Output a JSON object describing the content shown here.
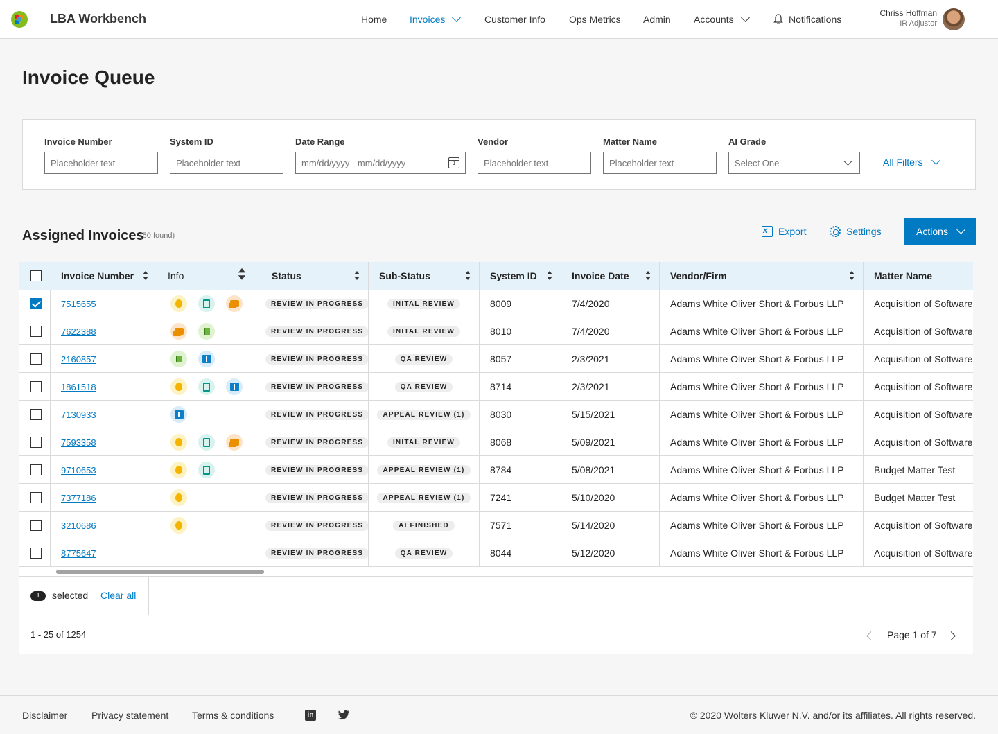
{
  "header": {
    "app_title": "LBA Workbench",
    "nav": [
      {
        "label": "Home",
        "left": 0
      },
      {
        "label": "Invoices"
      },
      {
        "label": "Customer Info"
      },
      {
        "label": "Ops Metrics"
      },
      {
        "label": "Admin"
      },
      {
        "label": "Accounts"
      },
      {
        "label": "Notifications"
      }
    ],
    "user_name": "Chriss Hoffman",
    "user_role": "IR Adjustor"
  },
  "page_title": "Invoice Queue",
  "filters": {
    "invoice_number_label": "Invoice Number",
    "invoice_number_placeholder": "Placeholder text",
    "system_id_label": "System ID",
    "system_id_placeholder": "Placeholder text",
    "date_range_label": "Date Range",
    "date_range_placeholder": "mm/dd/yyyy - mm/dd/yyyy",
    "vendor_label": "Vendor",
    "vendor_placeholder": "Placeholder text",
    "matter_name_label": "Matter Name",
    "matter_name_placeholder": "Placeholder text",
    "ai_grade_label": "AI Grade",
    "ai_grade_value": "Select One",
    "all_filters": "All Filters"
  },
  "section": {
    "title": "Assigned Invoices",
    "found": "(50 found)",
    "export": "Export",
    "settings": "Settings",
    "actions": "Actions"
  },
  "table": {
    "columns": [
      "Invoice Number",
      "Info",
      "Status",
      "Sub-Status",
      "System ID",
      "Invoice Date",
      "Vendor/Firm",
      "Matter Name"
    ],
    "rows": [
      {
        "checked": true,
        "invoice": "7515655",
        "icons": [
          "money-icon",
          "document-icon",
          "chat-icon"
        ],
        "status": "REVIEW IN PROGRESS",
        "substatus": "INITAL REVIEW",
        "system_id": "8009",
        "date": "7/4/2020",
        "vendor": "Adams White Oliver Short & Forbus LLP",
        "matter": "Acquisition of Software"
      },
      {
        "checked": false,
        "invoice": "7622388",
        "icons": [
          "chat-icon",
          "flag-icon"
        ],
        "status": "REVIEW IN PROGRESS",
        "substatus": "INITAL REVIEW",
        "system_id": "8010",
        "date": "7/4/2020",
        "vendor": "Adams White Oliver Short & Forbus LLP",
        "matter": "Acquisition of Software"
      },
      {
        "checked": false,
        "invoice": "2160857",
        "icons": [
          "flag-icon",
          "book-icon"
        ],
        "status": "REVIEW IN PROGRESS",
        "substatus": "QA REVIEW",
        "system_id": "8057",
        "date": "2/3/2021",
        "vendor": "Adams White Oliver Short & Forbus LLP",
        "matter": "Acquisition of Software"
      },
      {
        "checked": false,
        "invoice": "1861518",
        "icons": [
          "money-icon",
          "document-icon",
          "book-icon"
        ],
        "status": "REVIEW IN PROGRESS",
        "substatus": "QA REVIEW",
        "system_id": "8714",
        "date": "2/3/2021",
        "vendor": "Adams White Oliver Short & Forbus LLP",
        "matter": "Acquisition of Software"
      },
      {
        "checked": false,
        "invoice": "7130933",
        "icons": [
          "book-icon"
        ],
        "status": "REVIEW IN PROGRESS",
        "substatus": "APPEAL REVIEW (1)",
        "system_id": "8030",
        "date": "5/15/2021",
        "vendor": "Adams White Oliver Short & Forbus LLP",
        "matter": "Acquisition of Software"
      },
      {
        "checked": false,
        "invoice": "7593358",
        "icons": [
          "money-icon",
          "document-icon",
          "chat-icon"
        ],
        "status": "REVIEW IN PROGRESS",
        "substatus": "INITAL REVIEW",
        "system_id": "8068",
        "date": "5/09/2021",
        "vendor": "Adams White Oliver Short & Forbus LLP",
        "matter": "Acquisition of Software"
      },
      {
        "checked": false,
        "invoice": "9710653",
        "icons": [
          "money-icon",
          "document-icon"
        ],
        "status": "REVIEW IN PROGRESS",
        "substatus": "APPEAL REVIEW (1)",
        "system_id": "8784",
        "date": "5/08/2021",
        "vendor": "Adams White Oliver Short & Forbus LLP",
        "matter": "Budget Matter Test"
      },
      {
        "checked": false,
        "invoice": "7377186",
        "icons": [
          "money-icon"
        ],
        "status": "REVIEW IN PROGRESS",
        "substatus": "APPEAL REVIEW (1)",
        "system_id": "7241",
        "date": "5/10/2020",
        "vendor": "Adams White Oliver Short & Forbus LLP",
        "matter": "Budget Matter Test"
      },
      {
        "checked": false,
        "invoice": "3210686",
        "icons": [
          "money-icon"
        ],
        "status": "REVIEW IN PROGRESS",
        "substatus": "AI FINISHED",
        "system_id": "7571",
        "date": "5/14/2020",
        "vendor": "Adams White Oliver Short & Forbus LLP",
        "matter": "Acquisition of Software"
      },
      {
        "checked": false,
        "invoice": "8775647",
        "icons": [],
        "status": "REVIEW IN PROGRESS",
        "substatus": "QA REVIEW",
        "system_id": "8044",
        "date": "5/12/2020",
        "vendor": "Adams White Oliver Short & Forbus LLP",
        "matter": "Acquisition of Software"
      }
    ]
  },
  "selection": {
    "count": "1",
    "text": "selected",
    "clear": "Clear all"
  },
  "pager": {
    "range": "1 - 25 of 1254",
    "page": "Page 1 of 7"
  },
  "footer": {
    "disclaimer": "Disclaimer",
    "privacy": "Privacy statement",
    "terms": "Terms & conditions",
    "linkedin_icon": "in",
    "twitter_icon": "twitter-icon",
    "copyright": "© 2020 Wolters Kluwer N.V. and/or its affiliates. All rights reserved."
  },
  "colors": {
    "brand": "#007ac3",
    "header_row": "#e5f2fa"
  }
}
